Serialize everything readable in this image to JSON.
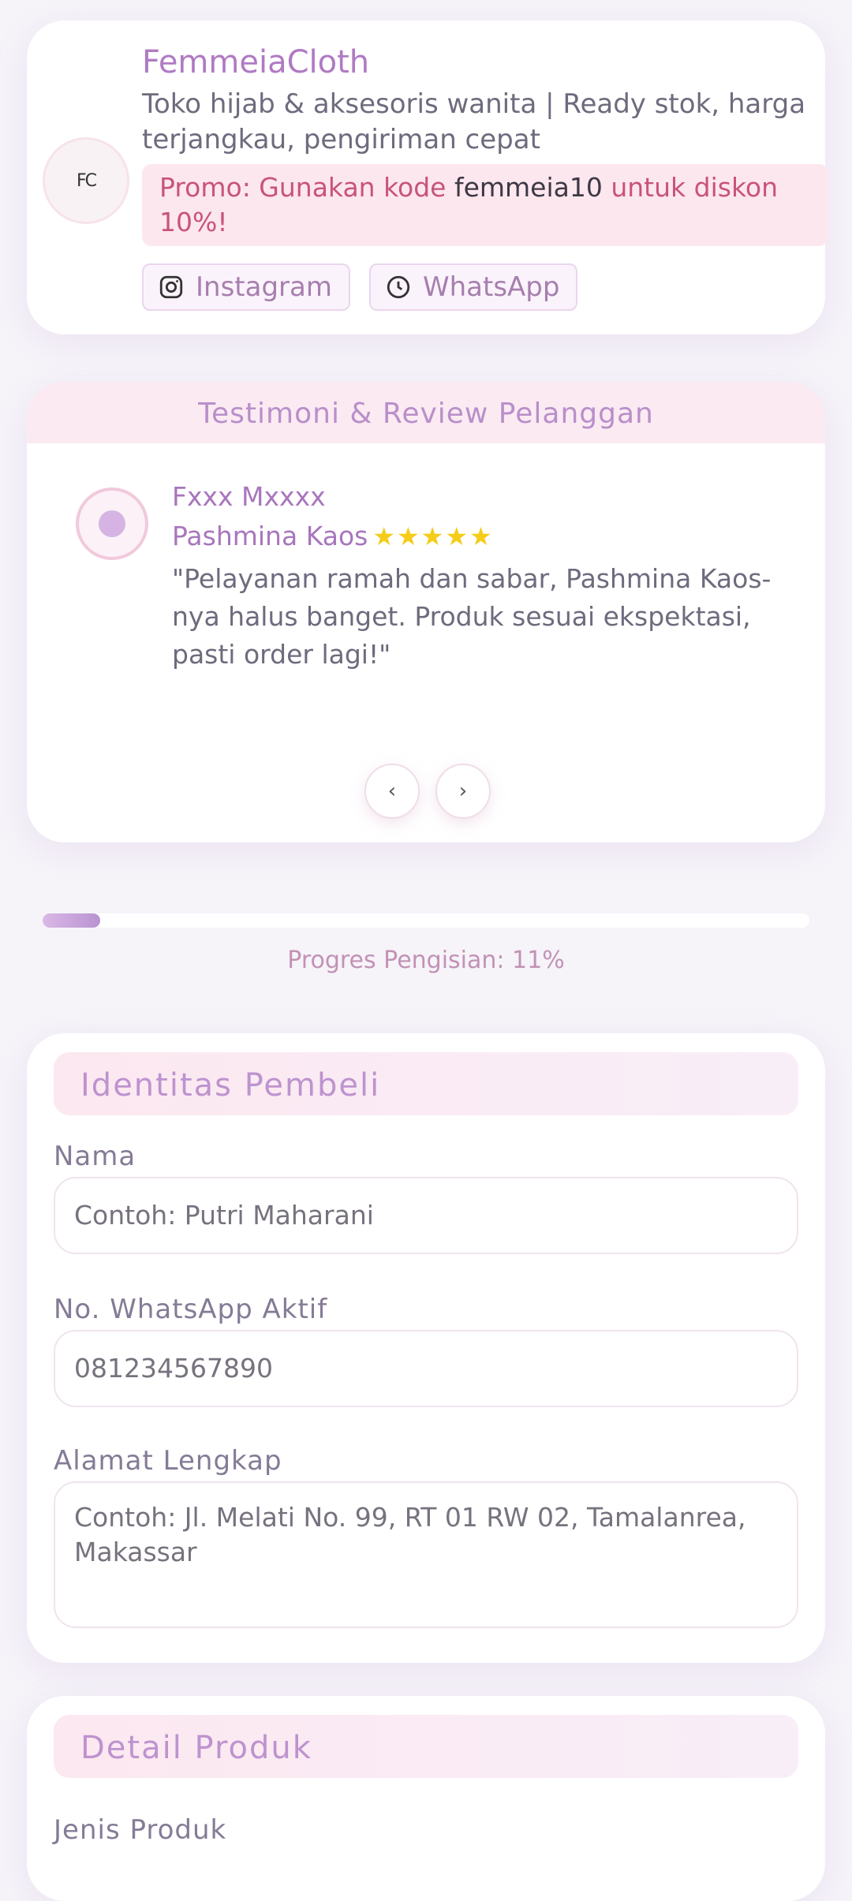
{
  "shop": {
    "logo_text": "FC",
    "name": "FemmeiaCloth",
    "description": "Toko hijab & aksesoris wanita | Ready stok, harga terjangkau, pengiriman cepat",
    "promo_prefix": "Promo: Gunakan kode ",
    "promo_code": "femmeia10",
    "promo_suffix": " untuk diskon 10%!",
    "instagram_label": "Instagram",
    "whatsapp_label": "WhatsApp"
  },
  "testimonials": {
    "title": "Testimoni & Review Pelanggan",
    "reviewer": "Fxxx Mxxxx",
    "product": "Pashmina Kaos",
    "stars": "★★★★★",
    "rating": 5,
    "quote": "\"Pelayanan ramah dan sabar, Pashmina Kaos-nya halus banget. Produk sesuai ekspektasi, pasti order lagi!\"",
    "prev_label": "‹",
    "next_label": "›"
  },
  "progress": {
    "percent": 11,
    "label": "Progres Pengisian: 11%"
  },
  "buyer": {
    "title": "Identitas Pembeli",
    "name_label": "Nama",
    "name_placeholder": "Contoh: Putri Maharani",
    "wa_label": "No. WhatsApp Aktif",
    "wa_placeholder": "081234567890",
    "address_label": "Alamat Lengkap",
    "address_placeholder": "Contoh: Jl. Melati No. 99, RT 01 RW 02, Tamalanrea, Makassar"
  },
  "product_detail": {
    "title": "Detail Produk",
    "type_label": "Jenis Produk"
  },
  "colors": {
    "accent": "#b07ac3",
    "promo_bg": "#fde7ee",
    "promo_text": "#c8537d",
    "star": "#f5cc17"
  }
}
